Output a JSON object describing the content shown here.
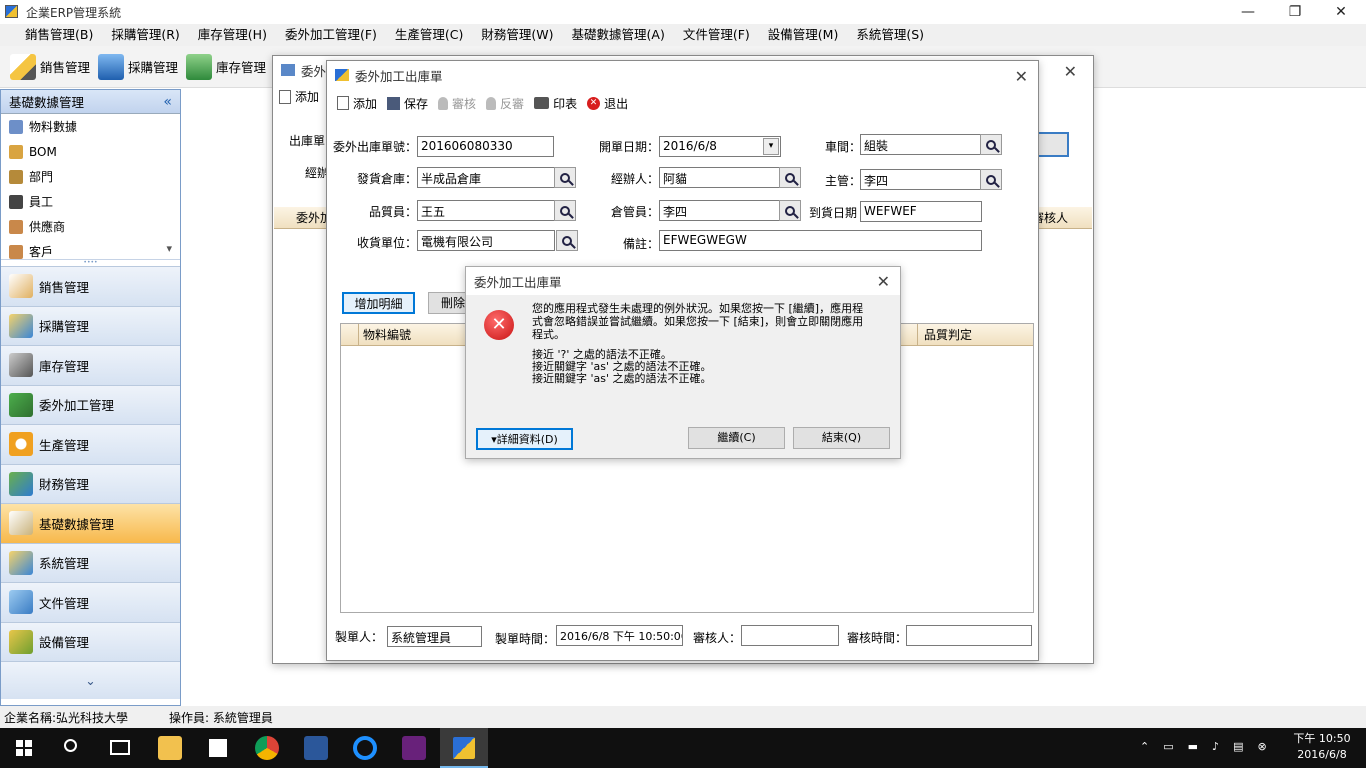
{
  "app": {
    "title": "企業ERP管理系統"
  },
  "window_buttons": {
    "minimize": "—",
    "restore": "❐",
    "close": "✕"
  },
  "menu": [
    "銷售管理(B)",
    "採購管理(R)",
    "庫存管理(H)",
    "委外加工管理(F)",
    "生產管理(C)",
    "財務管理(W)",
    "基礎數據管理(A)",
    "文件管理(F)",
    "設備管理(M)",
    "系統管理(S)"
  ],
  "toolbar": [
    {
      "label": "銷售管理",
      "icon": "pencil-icon"
    },
    {
      "label": "採購管理",
      "icon": "basket-icon"
    },
    {
      "label": "庫存管理",
      "icon": "house-icon"
    }
  ],
  "sidebar": {
    "header": "基礎數據管理",
    "collapse": "«",
    "items": [
      "物料數據",
      "BOM",
      "部門",
      "員工",
      "供應商",
      "客戶"
    ],
    "scroll_down": "▾",
    "grip": "••••",
    "nav": [
      "銷售管理",
      "採購管理",
      "庫存管理",
      "委外加工管理",
      "生產管理",
      "財務管理",
      "基礎數據管理",
      "系統管理",
      "文件管理",
      "設備管理"
    ],
    "nav_more": "⌄",
    "active_nav": "基礎數據管理"
  },
  "back_window": {
    "title": "委外",
    "add_label": "添加",
    "lbl_no": "出庫單",
    "lbl_agent": "經辦",
    "col_first": "委外加",
    "col_last": "審核人"
  },
  "form": {
    "title": "委外加工出庫單",
    "toolbar": {
      "add": "添加",
      "save": "保存",
      "audit": "審核",
      "unaudit": "反審",
      "print": "印表",
      "exit": "退出"
    },
    "labels": {
      "order_no": "委外出庫單號：",
      "open_date": "開單日期：",
      "workshop": "車間：",
      "warehouse": "發貨倉庫：",
      "agent": "經辦人：",
      "supervisor": "主管：",
      "inspector": "品質員：",
      "keeper": "倉管員：",
      "arrival_date": "到貨日期",
      "receiver": "收貨單位：",
      "remark": "備註："
    },
    "values": {
      "order_no": "201606080330",
      "open_date": "2016/6/8",
      "workshop": "組裝",
      "warehouse": "半成品倉庫",
      "agent": "阿貓",
      "supervisor": "李四",
      "inspector": "王五",
      "keeper": "李四",
      "arrival_date": "WEFWEF",
      "receiver": "電機有限公司",
      "remark": "EFWEGWEGW"
    },
    "buttons": {
      "add_detail": "增加明細",
      "delete": "刪除"
    },
    "grid": {
      "col_material": "物料編號",
      "col_quality": "品質判定"
    },
    "footer": {
      "creator_label": "製單人：",
      "creator": "系統管理員",
      "created_time_label": "製單時間：",
      "created_time": "2016/6/8 下午 10:50:06",
      "auditor_label": "審核人：",
      "auditor": "",
      "audit_time_label": "審核時間：",
      "audit_time": ""
    }
  },
  "dialog": {
    "title": "委外加工出庫單",
    "message": "您的應用程式發生未處理的例外狀況。如果您按一下 [繼續]，應用程式會忽略錯誤並嘗試繼續。如果您按一下 [結束]，則會立即關閉應用程式。",
    "details": [
      "接近 '?' 之處的語法不正確。",
      "接近關鍵字 'as' 之處的語法不正確。",
      "接近關鍵字 'as' 之處的語法不正確。"
    ],
    "btn_details": "▾詳細資料(D)",
    "btn_continue": "繼續(C)",
    "btn_quit": "結束(Q)"
  },
  "statusbar": {
    "company": "企業名稱:弘光科技大學",
    "operator": "操作員: 系統管理員"
  },
  "taskbar": {
    "time": "下午 10:50",
    "date": "2016/6/8"
  },
  "colors": {
    "accent": "#0078d7",
    "error_red": "#d81e1e",
    "nav_active": "#f7b84b"
  }
}
